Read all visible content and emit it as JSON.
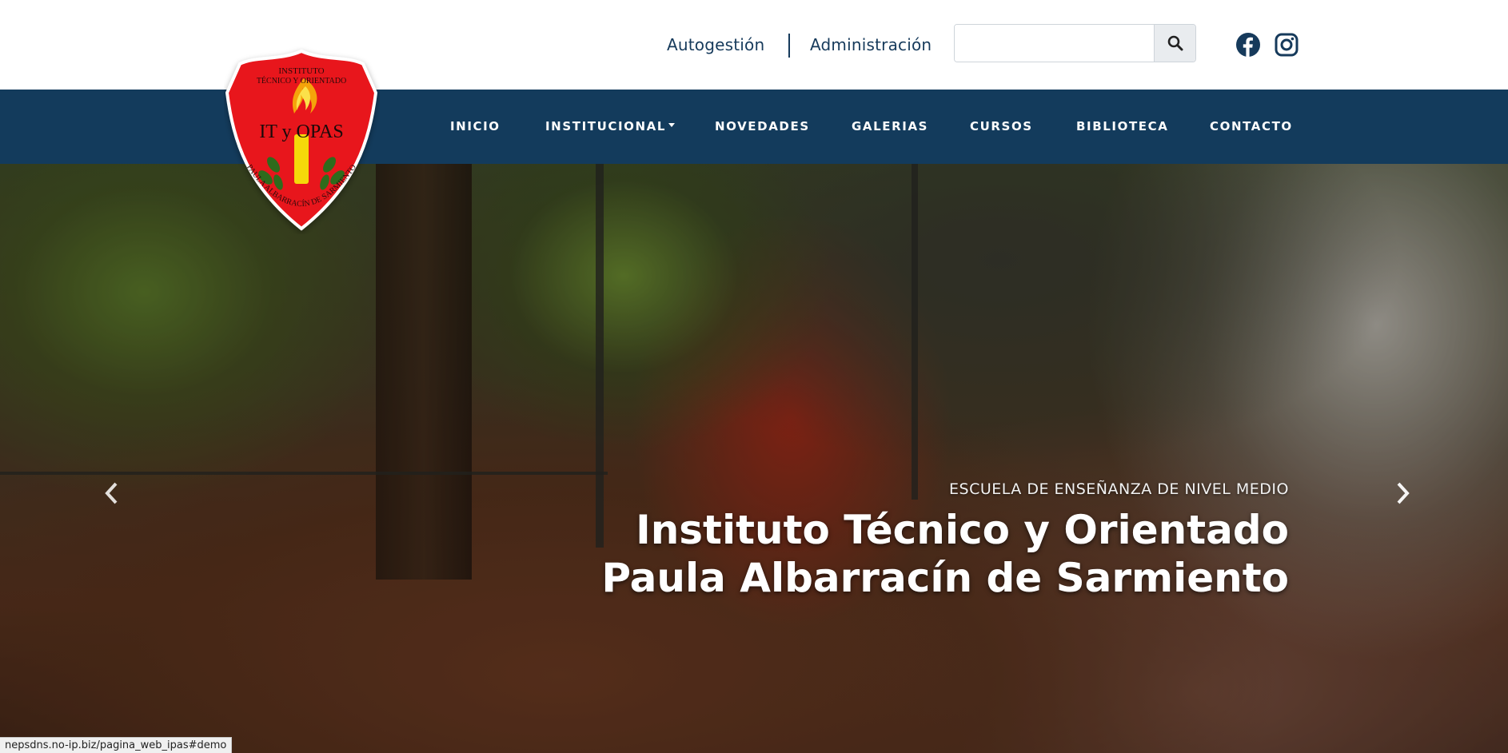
{
  "header": {
    "autogestion_label": "Autogestión",
    "administracion_label": "Administración",
    "search": {
      "value": "",
      "placeholder": ""
    }
  },
  "icons": {
    "search": "search-icon",
    "facebook": "facebook-icon",
    "instagram": "instagram-icon",
    "prev": "chevron-left-icon",
    "next": "chevron-right-icon"
  },
  "logo": {
    "top_text": "INSTITUTO",
    "line2_text": "TÉCNICO Y ORIENTADO",
    "monogram": "IT y OPAS",
    "bottom_text": "PAULA ALBARRACÍN DE SARMIENTO"
  },
  "nav": {
    "items": [
      {
        "label": "INICIO"
      },
      {
        "label": "INSTITUCIONAL"
      },
      {
        "label": "NOVEDADES"
      },
      {
        "label": "GALERIAS"
      },
      {
        "label": "CURSOS"
      },
      {
        "label": "BIBLIOTECA"
      },
      {
        "label": "CONTACTO"
      }
    ]
  },
  "hero": {
    "subtitle": "ESCUELA DE ENSEÑANZA DE NIVEL MEDIO",
    "title_line1": "Instituto Técnico y Orientado",
    "title_line2": "Paula Albarracín de Sarmiento"
  },
  "status": {
    "url": "nepsdns.no-ip.biz/pagina_web_ipas#demo"
  },
  "colors": {
    "navbar": "#133b5c",
    "link": "#163a5b",
    "logo_red": "#e8151b",
    "logo_yellow": "#f5d90a"
  }
}
